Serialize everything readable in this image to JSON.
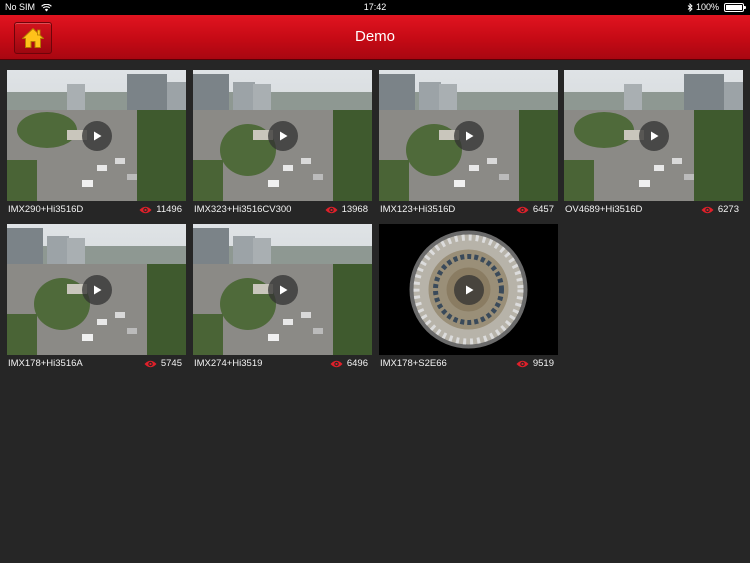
{
  "status_bar": {
    "carrier": "No SIM",
    "time": "17:42",
    "battery": "100%",
    "battery_level": 1.0
  },
  "nav": {
    "title": "Demo",
    "home_icon": "home-icon"
  },
  "videos": [
    {
      "name": "IMX290+Hi3516D",
      "views": "11496",
      "scene": "street"
    },
    {
      "name": "IMX323+Hi3516CV300",
      "views": "13968",
      "scene": "parking"
    },
    {
      "name": "IMX123+Hi3516D",
      "views": "6457",
      "scene": "parking"
    },
    {
      "name": "OV4689+Hi3516D",
      "views": "6273",
      "scene": "street"
    },
    {
      "name": "IMX178+Hi3516A",
      "views": "5745",
      "scene": "parking"
    },
    {
      "name": "IMX274+Hi3519",
      "views": "6496",
      "scene": "parking"
    },
    {
      "name": "IMX178+S2E66",
      "views": "9519",
      "scene": "fisheye"
    }
  ],
  "colors": {
    "accent": "#c50a15",
    "eye": "#e0202a",
    "background": "#262626"
  }
}
